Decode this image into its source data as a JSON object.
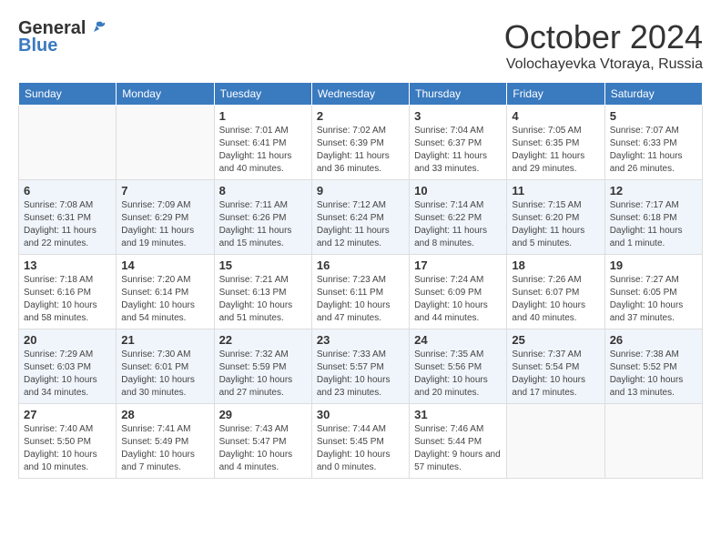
{
  "header": {
    "logo_general": "General",
    "logo_blue": "Blue",
    "month": "October 2024",
    "location": "Volochayevka Vtoraya, Russia"
  },
  "weekdays": [
    "Sunday",
    "Monday",
    "Tuesday",
    "Wednesday",
    "Thursday",
    "Friday",
    "Saturday"
  ],
  "weeks": [
    [
      {
        "day": "",
        "info": ""
      },
      {
        "day": "",
        "info": ""
      },
      {
        "day": "1",
        "info": "Sunrise: 7:01 AM\nSunset: 6:41 PM\nDaylight: 11 hours and 40 minutes."
      },
      {
        "day": "2",
        "info": "Sunrise: 7:02 AM\nSunset: 6:39 PM\nDaylight: 11 hours and 36 minutes."
      },
      {
        "day": "3",
        "info": "Sunrise: 7:04 AM\nSunset: 6:37 PM\nDaylight: 11 hours and 33 minutes."
      },
      {
        "day": "4",
        "info": "Sunrise: 7:05 AM\nSunset: 6:35 PM\nDaylight: 11 hours and 29 minutes."
      },
      {
        "day": "5",
        "info": "Sunrise: 7:07 AM\nSunset: 6:33 PM\nDaylight: 11 hours and 26 minutes."
      }
    ],
    [
      {
        "day": "6",
        "info": "Sunrise: 7:08 AM\nSunset: 6:31 PM\nDaylight: 11 hours and 22 minutes."
      },
      {
        "day": "7",
        "info": "Sunrise: 7:09 AM\nSunset: 6:29 PM\nDaylight: 11 hours and 19 minutes."
      },
      {
        "day": "8",
        "info": "Sunrise: 7:11 AM\nSunset: 6:26 PM\nDaylight: 11 hours and 15 minutes."
      },
      {
        "day": "9",
        "info": "Sunrise: 7:12 AM\nSunset: 6:24 PM\nDaylight: 11 hours and 12 minutes."
      },
      {
        "day": "10",
        "info": "Sunrise: 7:14 AM\nSunset: 6:22 PM\nDaylight: 11 hours and 8 minutes."
      },
      {
        "day": "11",
        "info": "Sunrise: 7:15 AM\nSunset: 6:20 PM\nDaylight: 11 hours and 5 minutes."
      },
      {
        "day": "12",
        "info": "Sunrise: 7:17 AM\nSunset: 6:18 PM\nDaylight: 11 hours and 1 minute."
      }
    ],
    [
      {
        "day": "13",
        "info": "Sunrise: 7:18 AM\nSunset: 6:16 PM\nDaylight: 10 hours and 58 minutes."
      },
      {
        "day": "14",
        "info": "Sunrise: 7:20 AM\nSunset: 6:14 PM\nDaylight: 10 hours and 54 minutes."
      },
      {
        "day": "15",
        "info": "Sunrise: 7:21 AM\nSunset: 6:13 PM\nDaylight: 10 hours and 51 minutes."
      },
      {
        "day": "16",
        "info": "Sunrise: 7:23 AM\nSunset: 6:11 PM\nDaylight: 10 hours and 47 minutes."
      },
      {
        "day": "17",
        "info": "Sunrise: 7:24 AM\nSunset: 6:09 PM\nDaylight: 10 hours and 44 minutes."
      },
      {
        "day": "18",
        "info": "Sunrise: 7:26 AM\nSunset: 6:07 PM\nDaylight: 10 hours and 40 minutes."
      },
      {
        "day": "19",
        "info": "Sunrise: 7:27 AM\nSunset: 6:05 PM\nDaylight: 10 hours and 37 minutes."
      }
    ],
    [
      {
        "day": "20",
        "info": "Sunrise: 7:29 AM\nSunset: 6:03 PM\nDaylight: 10 hours and 34 minutes."
      },
      {
        "day": "21",
        "info": "Sunrise: 7:30 AM\nSunset: 6:01 PM\nDaylight: 10 hours and 30 minutes."
      },
      {
        "day": "22",
        "info": "Sunrise: 7:32 AM\nSunset: 5:59 PM\nDaylight: 10 hours and 27 minutes."
      },
      {
        "day": "23",
        "info": "Sunrise: 7:33 AM\nSunset: 5:57 PM\nDaylight: 10 hours and 23 minutes."
      },
      {
        "day": "24",
        "info": "Sunrise: 7:35 AM\nSunset: 5:56 PM\nDaylight: 10 hours and 20 minutes."
      },
      {
        "day": "25",
        "info": "Sunrise: 7:37 AM\nSunset: 5:54 PM\nDaylight: 10 hours and 17 minutes."
      },
      {
        "day": "26",
        "info": "Sunrise: 7:38 AM\nSunset: 5:52 PM\nDaylight: 10 hours and 13 minutes."
      }
    ],
    [
      {
        "day": "27",
        "info": "Sunrise: 7:40 AM\nSunset: 5:50 PM\nDaylight: 10 hours and 10 minutes."
      },
      {
        "day": "28",
        "info": "Sunrise: 7:41 AM\nSunset: 5:49 PM\nDaylight: 10 hours and 7 minutes."
      },
      {
        "day": "29",
        "info": "Sunrise: 7:43 AM\nSunset: 5:47 PM\nDaylight: 10 hours and 4 minutes."
      },
      {
        "day": "30",
        "info": "Sunrise: 7:44 AM\nSunset: 5:45 PM\nDaylight: 10 hours and 0 minutes."
      },
      {
        "day": "31",
        "info": "Sunrise: 7:46 AM\nSunset: 5:44 PM\nDaylight: 9 hours and 57 minutes."
      },
      {
        "day": "",
        "info": ""
      },
      {
        "day": "",
        "info": ""
      }
    ]
  ]
}
